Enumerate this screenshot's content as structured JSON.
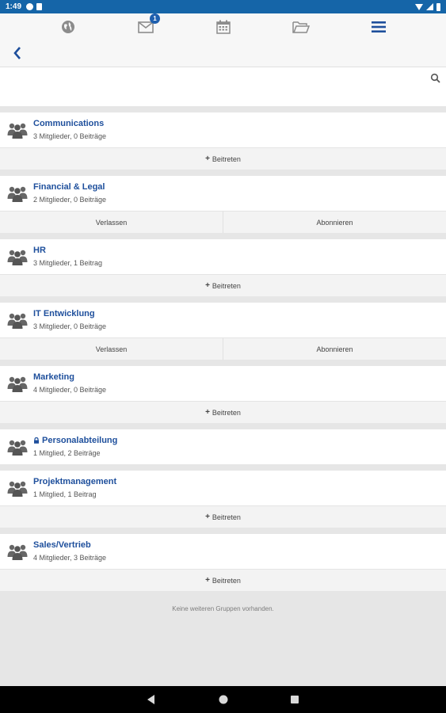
{
  "status_bar": {
    "time": "1:49"
  },
  "nav": {
    "badge_count": "1",
    "icons": [
      "globe-icon",
      "mail-icon",
      "calendar-icon",
      "folder-icon",
      "menu-icon"
    ]
  },
  "search": {
    "placeholder": ""
  },
  "groups": [
    {
      "name": "Communications",
      "meta": "3 Mitglieder, 0 Beiträge",
      "locked": false,
      "actions": [
        "Beitreten"
      ]
    },
    {
      "name": "Financial & Legal",
      "meta": "2 Mitglieder, 0 Beiträge",
      "locked": false,
      "actions": [
        "Verlassen",
        "Abonnieren"
      ]
    },
    {
      "name": "HR",
      "meta": "3 Mitglieder, 1 Beitrag",
      "locked": false,
      "actions": [
        "Beitreten"
      ]
    },
    {
      "name": "IT Entwicklung",
      "meta": "3 Mitglieder, 0 Beiträge",
      "locked": false,
      "actions": [
        "Verlassen",
        "Abonnieren"
      ]
    },
    {
      "name": "Marketing",
      "meta": "4 Mitglieder, 0 Beiträge",
      "locked": false,
      "actions": [
        "Beitreten"
      ]
    },
    {
      "name": "Personalabteilung",
      "meta": "1 Mitglied, 2 Beiträge",
      "locked": true,
      "actions": []
    },
    {
      "name": "Projektmanagement",
      "meta": "1 Mitglied, 1 Beitrag",
      "locked": false,
      "actions": [
        "Beitreten"
      ]
    },
    {
      "name": "Sales/Vertrieb",
      "meta": "4 Mitglieder, 3 Beiträge",
      "locked": false,
      "actions": [
        "Beitreten"
      ]
    }
  ],
  "footer_text": "Keine weiteren Gruppen vorhanden.",
  "colors": {
    "accent": "#1e4f9c",
    "status_bar": "#1565a8"
  }
}
